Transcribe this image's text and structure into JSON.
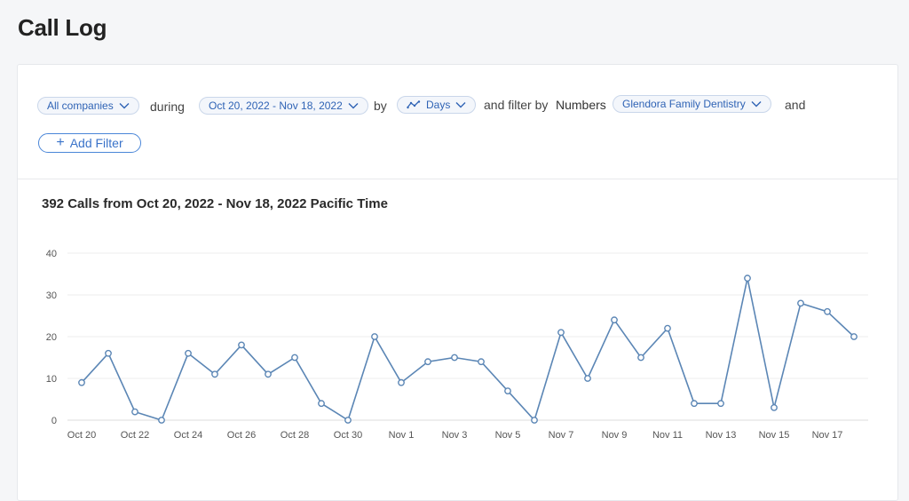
{
  "page": {
    "title": "Call Log"
  },
  "filters": {
    "company": "All companies",
    "during_label": "during",
    "date_range": "Oct 20, 2022 - Nov 18, 2022",
    "by_label": "by",
    "granularity": "Days",
    "filter_by_label": "and filter by",
    "numbers_label": "Numbers",
    "number_value": "Glendora Family Dentistry",
    "and_label": "and",
    "add_filter": "Add Filter"
  },
  "chart": {
    "title": "392 Calls from Oct 20, 2022 - Nov 18, 2022 Pacific Time"
  },
  "chart_data": {
    "type": "line",
    "x": [
      "Oct 20",
      "Oct 21",
      "Oct 22",
      "Oct 23",
      "Oct 24",
      "Oct 25",
      "Oct 26",
      "Oct 27",
      "Oct 28",
      "Oct 29",
      "Oct 30",
      "Oct 31",
      "Nov 1",
      "Nov 2",
      "Nov 3",
      "Nov 4",
      "Nov 5",
      "Nov 6",
      "Nov 7",
      "Nov 8",
      "Nov 9",
      "Nov 10",
      "Nov 11",
      "Nov 12",
      "Nov 13",
      "Nov 14",
      "Nov 15",
      "Nov 16",
      "Nov 17",
      "Nov 18"
    ],
    "tick_labels": [
      "Oct 20",
      "Oct 22",
      "Oct 24",
      "Oct 26",
      "Oct 28",
      "Oct 30",
      "Nov 1",
      "Nov 3",
      "Nov 5",
      "Nov 7",
      "Nov 9",
      "Nov 11",
      "Nov 13",
      "Nov 15",
      "Nov 17"
    ],
    "values": [
      9,
      16,
      2,
      0,
      16,
      11,
      18,
      11,
      15,
      4,
      0,
      20,
      9,
      14,
      15,
      14,
      7,
      0,
      21,
      10,
      24,
      15,
      22,
      4,
      4,
      34,
      3,
      28,
      26,
      20
    ],
    "yticks": [
      0,
      10,
      20,
      30,
      40
    ],
    "ylim": [
      0,
      40
    ],
    "grid": true,
    "color": "#5b86b5"
  }
}
